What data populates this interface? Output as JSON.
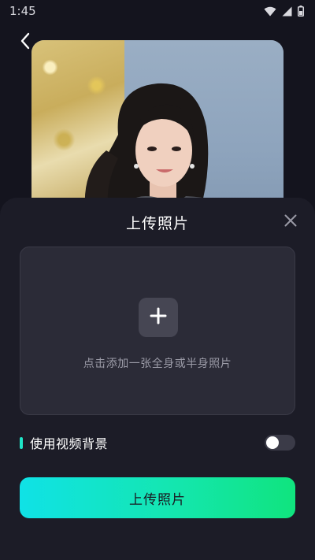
{
  "status_bar": {
    "time": "1:45",
    "icons": [
      "wifi-icon",
      "cellular-signal-icon",
      "battery-icon"
    ]
  },
  "header": {
    "back_icon": "chevron-left-icon"
  },
  "preview": {
    "description_icon": "portrait-photo"
  },
  "sheet": {
    "title": "上传照片",
    "close_icon": "close-icon",
    "upload_area": {
      "plus_icon": "plus-icon",
      "hint": "点击添加一张全身或半身照片"
    },
    "video_background": {
      "label": "使用视频背景",
      "enabled": false
    },
    "primary_button": {
      "label": "上传照片"
    }
  },
  "colors": {
    "background": "#14141e",
    "sheet": "#1c1c27",
    "accent": "#1fe5c8",
    "button_gradient_start": "#10e2e6",
    "button_gradient_end": "#10e47e"
  }
}
